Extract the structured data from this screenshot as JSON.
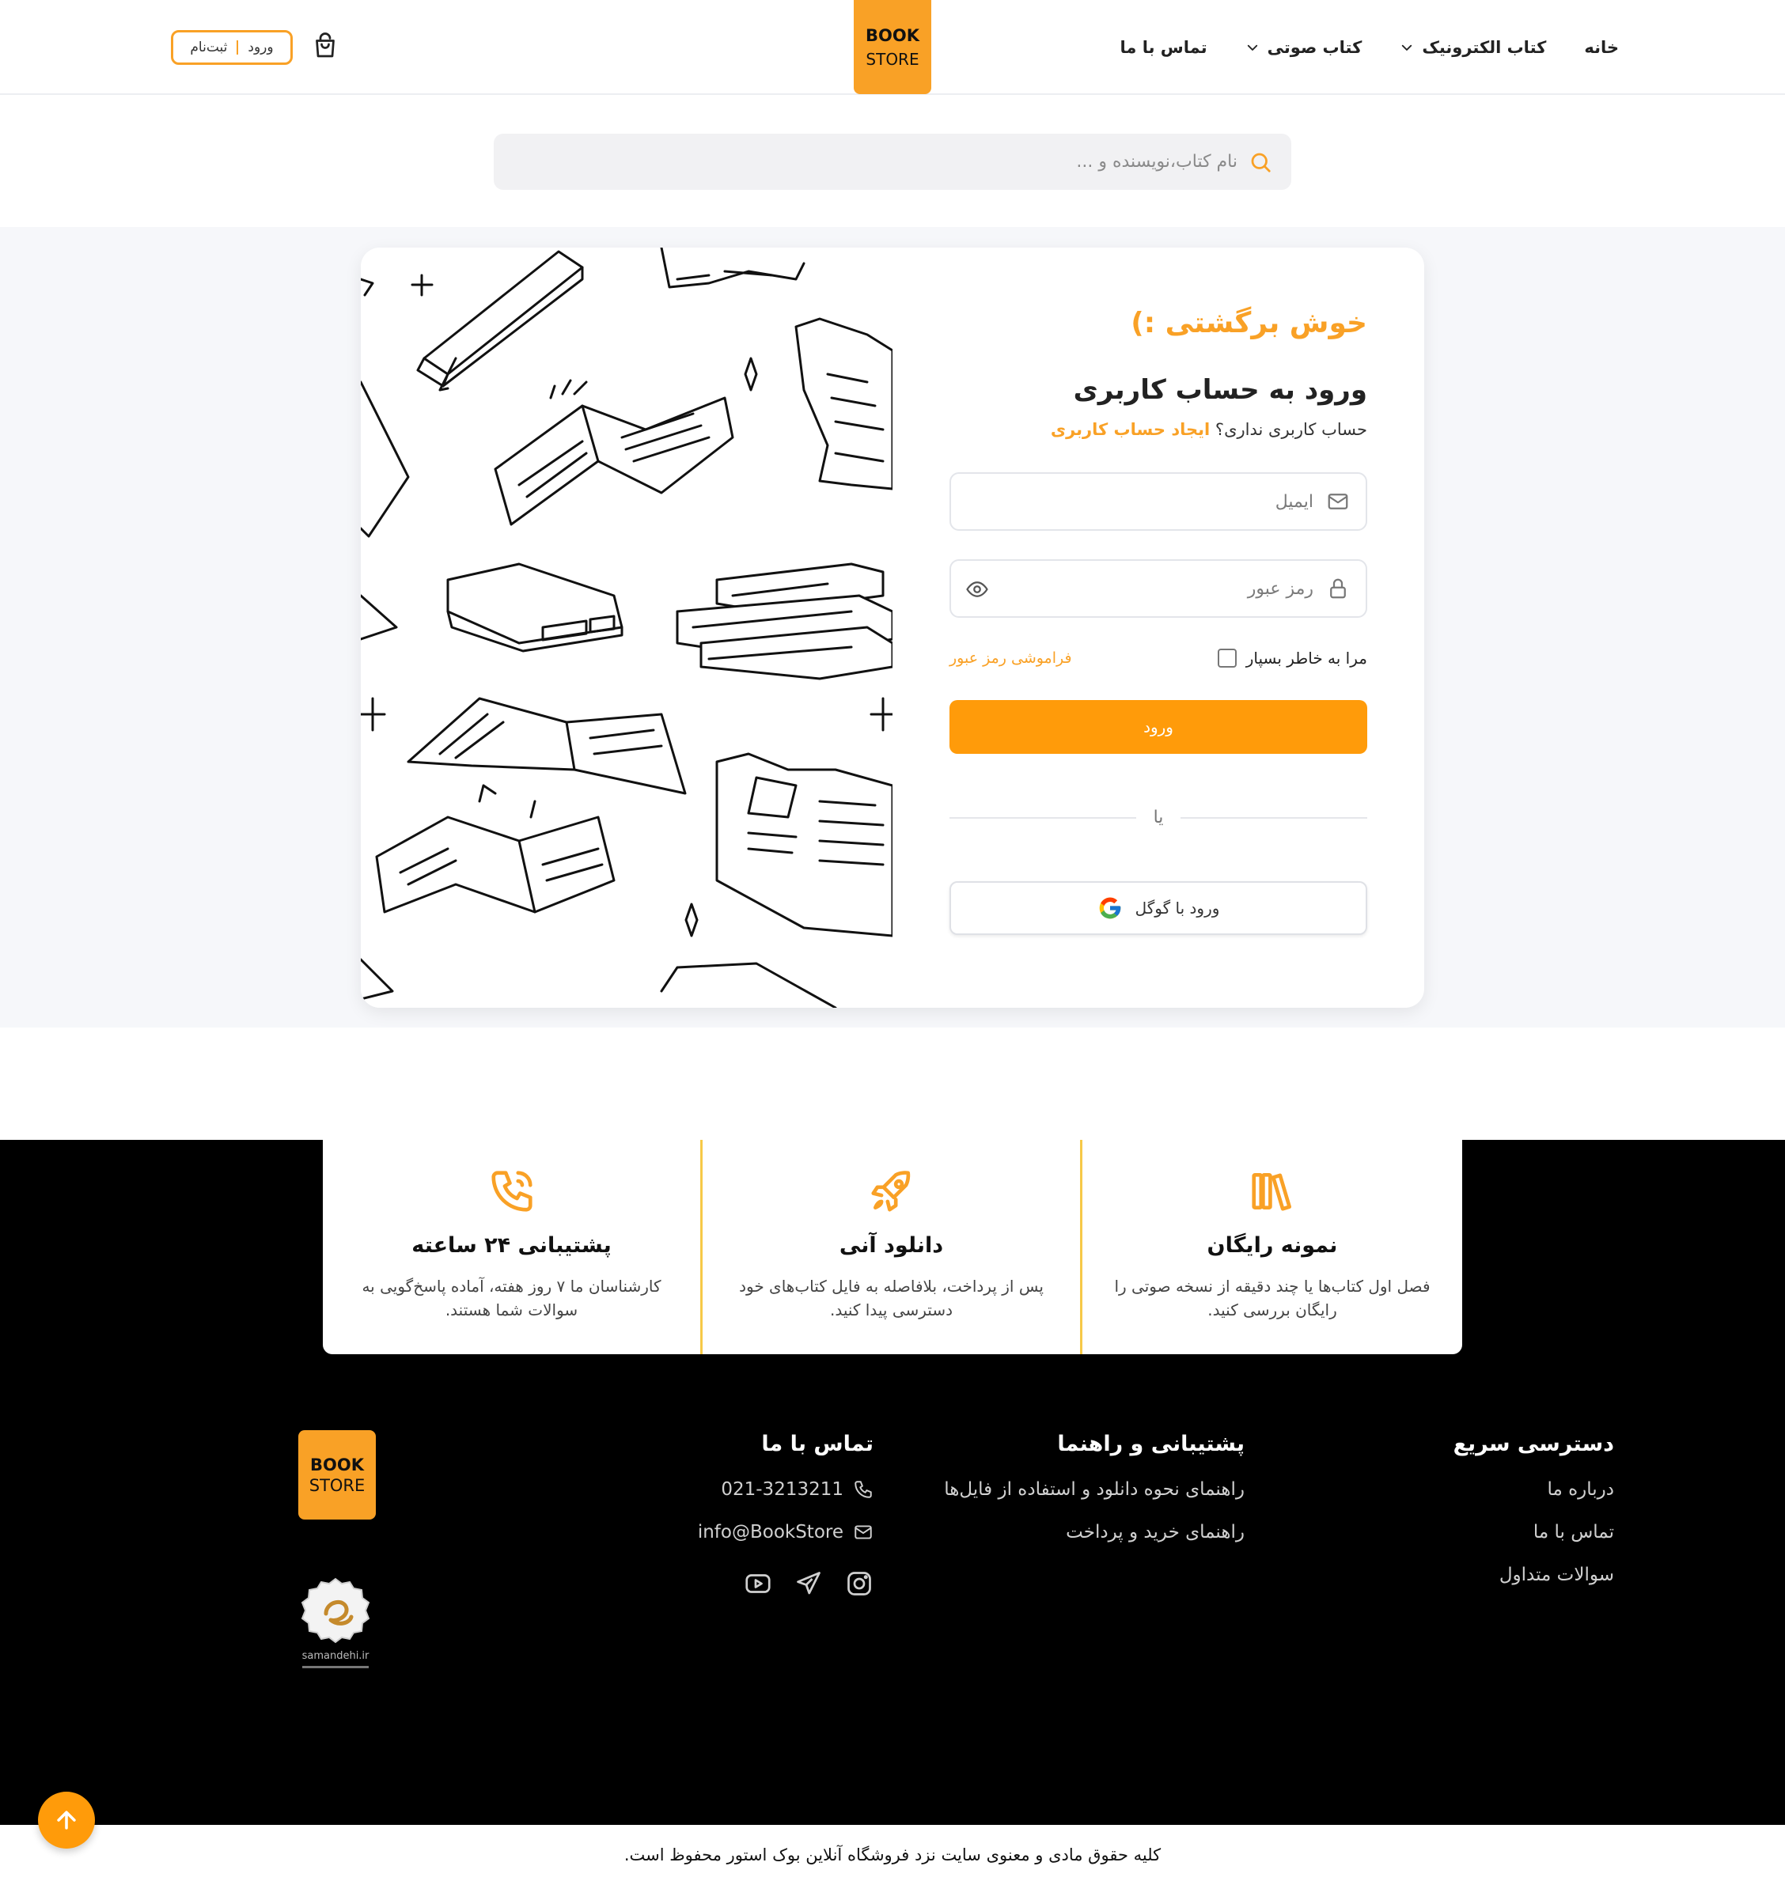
{
  "header": {
    "logo": {
      "line1": "BOOK",
      "line2": "STORE"
    },
    "nav": [
      {
        "label": "خانه",
        "dropdown": false
      },
      {
        "label": "کتاب الکترونیک",
        "dropdown": true
      },
      {
        "label": "کتاب صوتی",
        "dropdown": true
      },
      {
        "label": "تماس با ما",
        "dropdown": false
      }
    ],
    "auth": {
      "login": "ورود",
      "register": "ثبت‌نام"
    },
    "cart_icon": "shopping-bag-icon"
  },
  "search": {
    "placeholder": "نام کتاب،نویسنده و ...",
    "icon": "search-icon"
  },
  "login": {
    "welcome": "خوش برگشتی :)",
    "title": "ورود به حساب کاربری",
    "no_account": "حساب کاربری نداری؟",
    "create_account": "ایجاد حساب کاربری",
    "email_placeholder": "ایمیل",
    "password_placeholder": "رمز عبور",
    "remember_me": "مرا به خاطر بسپار",
    "forgot_password": "فراموشی رمز عبور",
    "submit": "ورود",
    "or": "یا",
    "google": "ورود با گوگل"
  },
  "features": [
    {
      "title": "نمونه رایگان",
      "desc": "فصل اول کتاب‌ها یا چند دقیقه از نسخه صوتی را رایگان بررسی کنید.",
      "icon": "library-icon"
    },
    {
      "title": "دانلود آنی",
      "desc": "پس از پرداخت، بلافاصله به فایل کتاب‌های خود دسترسی پیدا کنید.",
      "icon": "rocket-icon"
    },
    {
      "title": "پشتیبانی ۲۴ ساعته",
      "desc": "کارشناسان ما ۷ روز هفته، آماده پاسخ‌گویی به سوالات شما هستند.",
      "icon": "phone-call-icon"
    }
  ],
  "footer": {
    "quick": {
      "title": "دسترسی سریع",
      "links": [
        "درباره ما",
        "تماس با ما",
        "سوالات متداول"
      ]
    },
    "support": {
      "title": "پشتیبانی و راهنما",
      "links": [
        "راهنمای نحوه دانلود و استفاده از فایل‌ها",
        "راهنمای خرید و پرداخت"
      ]
    },
    "contact": {
      "title": "تماس با ما",
      "phone": "021-3213211",
      "email": "info@BookStore"
    },
    "logo": {
      "line1": "BOOK",
      "line2": "STORE"
    },
    "seal_text": "samandehi.ir",
    "copyright": "کلیه حقوق مادی و معنوی سایت نزد فروشگاه آنلاین بوک استور محفوظ است."
  },
  "colors": {
    "accent": "#f9a126",
    "button": "#ff9b0a",
    "footer_bg": "#000000",
    "feature_divider": "#f7c948"
  }
}
